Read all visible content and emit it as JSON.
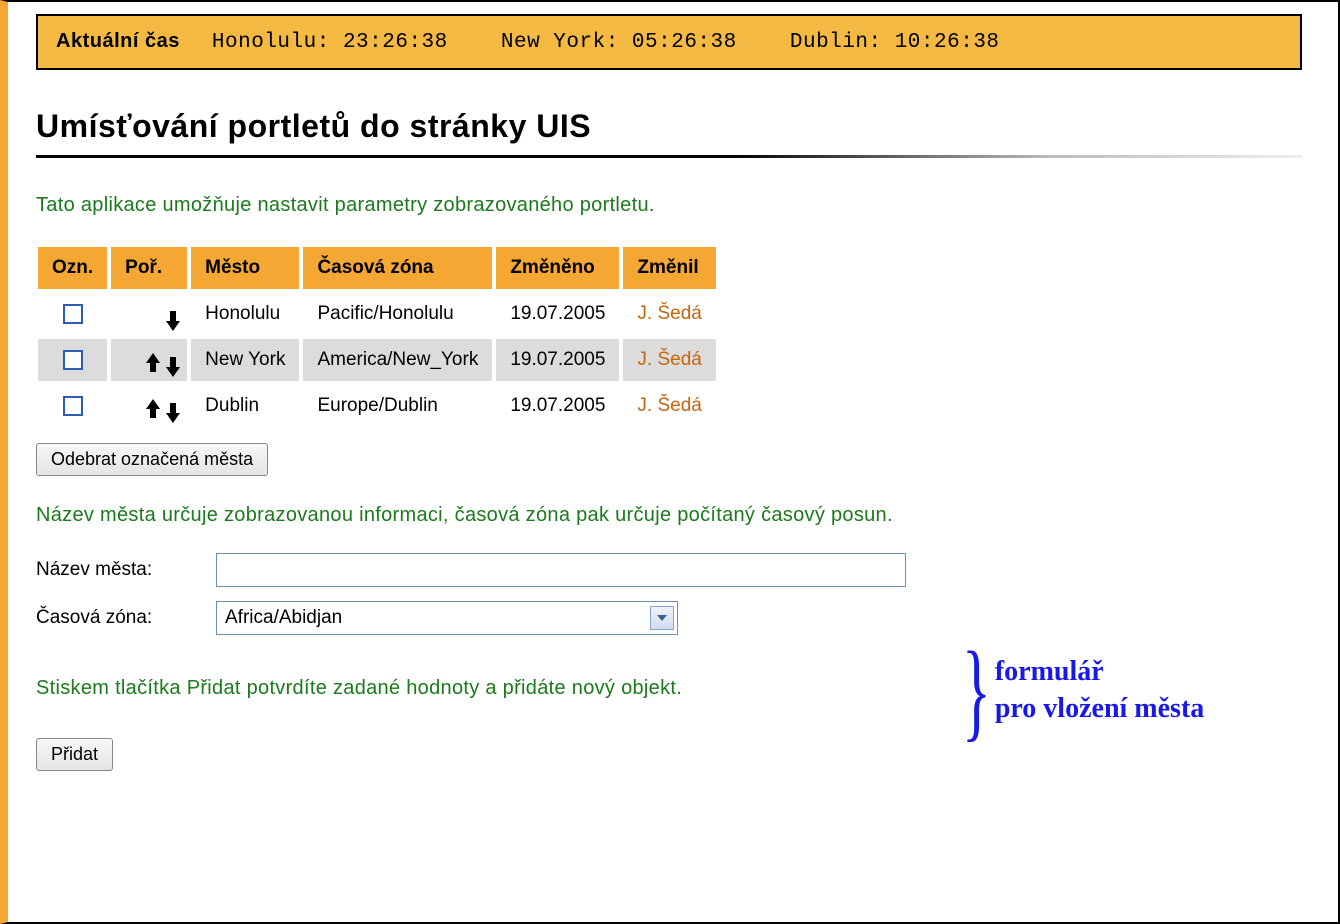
{
  "timebar": {
    "label": "Aktuální čas",
    "clocks": [
      {
        "city": "Honolulu",
        "time": "23:26:38"
      },
      {
        "city": "New York",
        "time": "05:26:38"
      },
      {
        "city": "Dublin",
        "time": "10:26:38"
      }
    ]
  },
  "title": "Umísťování portletů do stránky UIS",
  "intro": "Tato aplikace umožňuje nastavit parametry zobrazovaného portletu.",
  "table": {
    "headers": {
      "ozn": "Ozn.",
      "por": "Poř.",
      "mesto": "Město",
      "zona": "Časová zóna",
      "zmeneno": "Změněno",
      "zmenil": "Změnil"
    },
    "rows": [
      {
        "up": false,
        "down": true,
        "city": "Honolulu",
        "zone": "Pacific/Honolulu",
        "date": "19.07.2005",
        "user": "J. Šedá"
      },
      {
        "up": true,
        "down": true,
        "city": "New York",
        "zone": "America/New_York",
        "date": "19.07.2005",
        "user": "J. Šedá"
      },
      {
        "up": true,
        "down": true,
        "city": "Dublin",
        "zone": "Europe/Dublin",
        "date": "19.07.2005",
        "user": "J. Šedá"
      }
    ]
  },
  "remove_button": "Odebrat označená města",
  "help1": "Název města určuje zobrazovanou informaci, časová zóna pak určuje počítaný časový posun.",
  "form": {
    "city_label": "Název města:",
    "city_value": "",
    "zone_label": "Časová zóna:",
    "zone_value": "Africa/Abidjan"
  },
  "annotation": {
    "line1": "formulář",
    "line2": "pro vložení města"
  },
  "help2": "Stiskem tlačítka Přidat potvrdíte zadané hodnoty a přidáte nový objekt.",
  "add_button": "Přidat"
}
